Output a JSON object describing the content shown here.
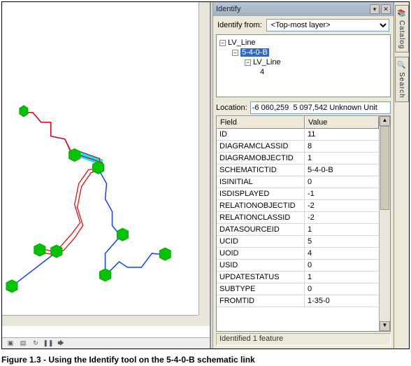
{
  "identify": {
    "title": "Identify",
    "from_label": "Identify from:",
    "from_value": "<Top-most layer>",
    "tree": {
      "root": "LV_Line",
      "sel": "5-4-0-B",
      "child": "LV_Line",
      "leaf": "4"
    },
    "location_label": "Location:",
    "location_value": "-6 060,259  5 097,542 Unknown Unit",
    "grid_field_header": "Field",
    "grid_value_header": "Value",
    "rows": [
      {
        "f": "ID",
        "v": "11"
      },
      {
        "f": "DIAGRAMCLASSID",
        "v": "8"
      },
      {
        "f": "DIAGRAMOBJECTID",
        "v": "1"
      },
      {
        "f": "SCHEMATICTID",
        "v": "5-4-0-B"
      },
      {
        "f": "ISINITIAL",
        "v": "0"
      },
      {
        "f": "ISDISPLAYED",
        "v": "-1"
      },
      {
        "f": "RELATIONOBJECTID",
        "v": "-2"
      },
      {
        "f": "RELATIONCLASSID",
        "v": "-2"
      },
      {
        "f": "DATASOURCEID",
        "v": "1"
      },
      {
        "f": "UCID",
        "v": "5"
      },
      {
        "f": "UOID",
        "v": "4"
      },
      {
        "f": "USID",
        "v": "0"
      },
      {
        "f": "UPDATESTATUS",
        "v": "1"
      },
      {
        "f": "SUBTYPE",
        "v": "0"
      },
      {
        "f": "FROMTID",
        "v": "1-35-0"
      }
    ],
    "status": "Identified 1 feature"
  },
  "side_tabs": {
    "catalog": "Catalog",
    "search": "Search"
  },
  "toolbar_icons": {
    "a": "▣",
    "b": "▤",
    "c": "↻",
    "d": "❚❚",
    "e": "🡆"
  },
  "caption": "Figure 1.3 - Using the Identify tool on the 5-4-0-B schematic link"
}
